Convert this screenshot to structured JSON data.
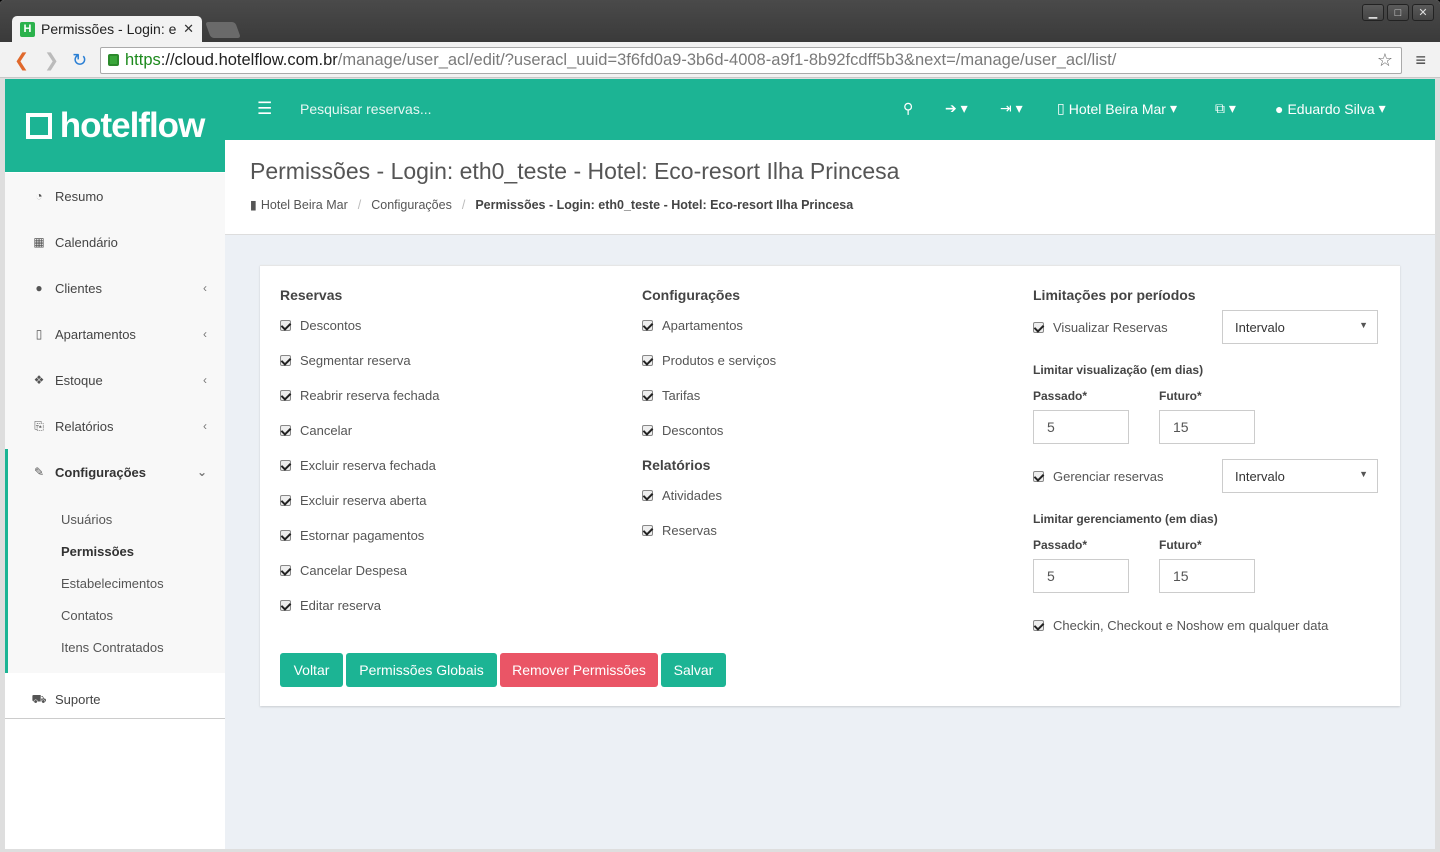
{
  "browser": {
    "tab_title": "Permissões - Login: e",
    "url_https": "https",
    "url_host": "://cloud.hotelflow.com.br",
    "url_rest": "/manage/user_acl/edit/?useracl_uuid=3f6fd0a9-3b6d-4008-a9f1-8b92fcdff5b3&next=/manage/user_acl/list/"
  },
  "logo": {
    "text": "hotelflow"
  },
  "header": {
    "search_placeholder": "Pesquisar reservas...",
    "hotel": "Hotel Beira Mar",
    "user": "Eduardo Silva"
  },
  "sidebar": {
    "items": [
      {
        "label": "Resumo",
        "icon": "dashboard-icon"
      },
      {
        "label": "Calendário",
        "icon": "calendar-icon"
      },
      {
        "label": "Clientes",
        "icon": "users-icon"
      },
      {
        "label": "Apartamentos",
        "icon": "building-icon"
      },
      {
        "label": "Estoque",
        "icon": "cubes-icon"
      },
      {
        "label": "Relatórios",
        "icon": "report-icon"
      },
      {
        "label": "Configurações",
        "icon": "wrench-icon"
      },
      {
        "label": "Suporte",
        "icon": "ambulance-icon"
      }
    ],
    "submenu": [
      "Usuários",
      "Permissões",
      "Estabelecimentos",
      "Contatos",
      "Itens Contratados"
    ]
  },
  "page": {
    "title": "Permissões - Login: eth0_teste - Hotel: Eco-resort Ilha Princesa",
    "breadcrumb": [
      "Hotel Beira Mar",
      "Configurações",
      "Permissões - Login: eth0_teste - Hotel: Eco-resort Ilha Princesa"
    ]
  },
  "reservas": {
    "title": "Reservas",
    "items": [
      "Descontos",
      "Segmentar reserva",
      "Reabrir reserva fechada",
      "Cancelar",
      "Excluir reserva fechada",
      "Excluir reserva aberta",
      "Estornar pagamentos",
      "Cancelar Despesa",
      "Editar reserva"
    ]
  },
  "configuracoes": {
    "title": "Configurações",
    "items": [
      "Apartamentos",
      "Produtos e serviços",
      "Tarifas",
      "Descontos"
    ]
  },
  "relatorios": {
    "title": "Relatórios",
    "items": [
      "Atividades",
      "Reservas"
    ]
  },
  "limitacoes": {
    "title": "Limitações por períodos",
    "visualizar": "Visualizar Reservas",
    "visualizar_select": "Intervalo",
    "limitar_vis": "Limitar visualização (em dias)",
    "gerenciar": "Gerenciar reservas",
    "gerenciar_select": "Intervalo",
    "limitar_ger": "Limitar gerenciamento (em dias)",
    "passado_label": "Passado*",
    "futuro_label": "Futuro*",
    "vis_passado": "5",
    "vis_futuro": "15",
    "ger_passado": "5",
    "ger_futuro": "15",
    "checkin": "Checkin, Checkout e Noshow em qualquer data"
  },
  "buttons": {
    "voltar": "Voltar",
    "globais": "Permissões Globais",
    "remover": "Remover Permissões",
    "salvar": "Salvar"
  },
  "colors": {
    "accent": "#1cb494",
    "danger": "#ea5566"
  }
}
